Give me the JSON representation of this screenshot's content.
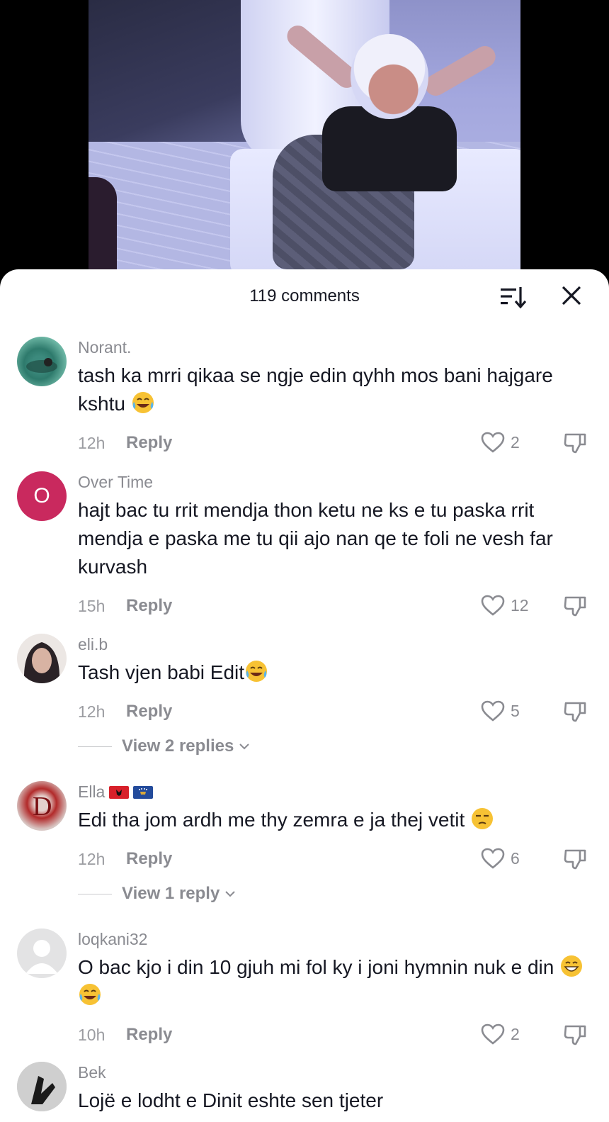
{
  "header": {
    "comments_count": "119 comments"
  },
  "icons": {
    "sort": "sort-icon",
    "close": "close-icon",
    "like": "heart-outline-icon",
    "dislike": "thumbs-down-icon",
    "emoji_laugh": "face-with-tears-of-joy-emoji",
    "emoji_grin": "grinning-face-emoji",
    "emoji_unamused": "unamused-face-emoji"
  },
  "colors": {
    "text_primary": "#161823",
    "text_secondary": "#8a8b91",
    "avatar_over_time": "#c9295e"
  },
  "reply_label": "Reply",
  "comments": [
    {
      "username": "Norant.",
      "text": "tash ka mrri qikaa se ngje edin qyhh mos bani hajgare kshtu",
      "time": "12h",
      "likes": "2"
    },
    {
      "username": "Over Time",
      "avatar_letter": "O",
      "text": "hajt bac tu rrit mendja thon ketu ne ks e tu paska rrit mendja e paska me tu qii ajo nan qe te foli ne vesh far kurvash",
      "time": "15h",
      "likes": "12"
    },
    {
      "username": "eli.b",
      "text": "Tash vjen babi Edit",
      "time": "12h",
      "likes": "5",
      "view_replies": "View 2 replies"
    },
    {
      "username": "Ella",
      "text": "Edi tha jom ardh me thy zemra e ja thej vetit",
      "time": "12h",
      "likes": "6",
      "view_replies": "View 1 reply"
    },
    {
      "username": "loqkani32",
      "text": "O bac kjo i din 10 gjuh mi fol ky i joni hymnin nuk e din",
      "time": "10h",
      "likes": "2"
    },
    {
      "username": "Bek",
      "text": "Lojë e lodht e Dinit eshte sen tjeter"
    }
  ]
}
